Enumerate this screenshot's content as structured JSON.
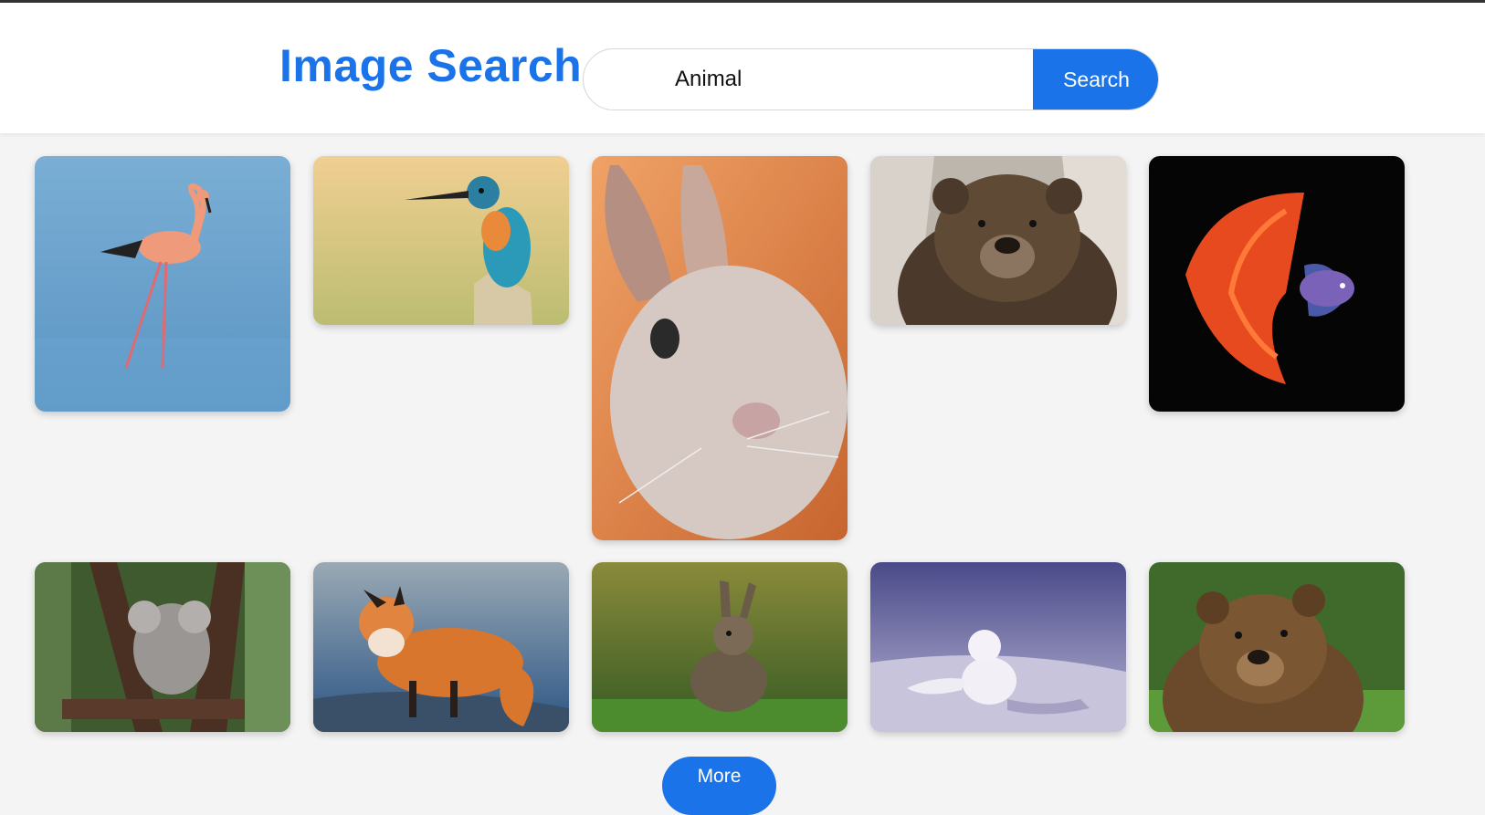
{
  "header": {
    "title": "Image Search",
    "search_value": "Animal",
    "search_button_label": "Search"
  },
  "gallery": {
    "images": [
      {
        "subject": "flamingo"
      },
      {
        "subject": "kingfisher"
      },
      {
        "subject": "rabbit"
      },
      {
        "subject": "bear"
      },
      {
        "subject": "betta-fish"
      },
      {
        "subject": "koala"
      },
      {
        "subject": "fox"
      },
      {
        "subject": "wild-rabbit"
      },
      {
        "subject": "arctic-fox"
      },
      {
        "subject": "brown-bear"
      }
    ]
  },
  "more_button_label": "More",
  "colors": {
    "accent": "#1a73e8",
    "background": "#f4f4f4",
    "header_bg": "#ffffff"
  }
}
